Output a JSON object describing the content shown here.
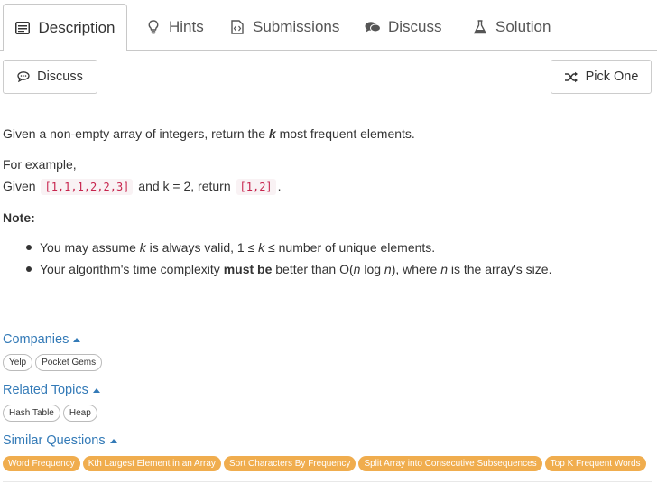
{
  "tabs": [
    {
      "label": "Description",
      "icon": "list-icon"
    },
    {
      "label": "Hints",
      "icon": "lightbulb-icon"
    },
    {
      "label": "Submissions",
      "icon": "file-code-icon"
    },
    {
      "label": "Discuss",
      "icon": "comments-icon"
    },
    {
      "label": "Solution",
      "icon": "flask-icon"
    }
  ],
  "toolbar": {
    "discuss_label": "Discuss",
    "pick_label": "Pick One"
  },
  "problem": {
    "p1_a": "Given a non-empty array of integers, return the ",
    "p1_k": "k",
    "p1_b": " most frequent elements.",
    "for_example": "For example,",
    "given": "Given ",
    "code1": "[1,1,1,2,2,3]",
    "and_k": " and k = 2, return ",
    "code2": "[1,2]",
    "period": ".",
    "note": "Note:",
    "b1_a": "You may assume ",
    "b1_k": "k",
    "b1_b": " is always valid, 1 ≤ ",
    "b1_k2": "k",
    "b1_c": " ≤ number of unique elements.",
    "b2_a": "Your algorithm's time complexity ",
    "b2_bold": "must be",
    "b2_b": " better than O(",
    "b2_n": "n",
    "b2_c": " log ",
    "b2_n2": "n",
    "b2_d": "), where ",
    "b2_n3": "n",
    "b2_e": " is the array's size."
  },
  "companies": {
    "title": "Companies",
    "tags": [
      "Yelp",
      "Pocket Gems"
    ]
  },
  "topics": {
    "title": "Related Topics",
    "tags": [
      "Hash Table",
      "Heap"
    ]
  },
  "similar": {
    "title": "Similar Questions",
    "tags": [
      "Word Frequency",
      "Kth Largest Element in an Array",
      "Sort Characters By Frequency",
      "Split Array into Consecutive Subsequences",
      "Top K Frequent Words"
    ]
  },
  "colors": {
    "accent": "#337ab7",
    "tag_orange": "#f0ad4e",
    "code_red": "#c7254e"
  }
}
